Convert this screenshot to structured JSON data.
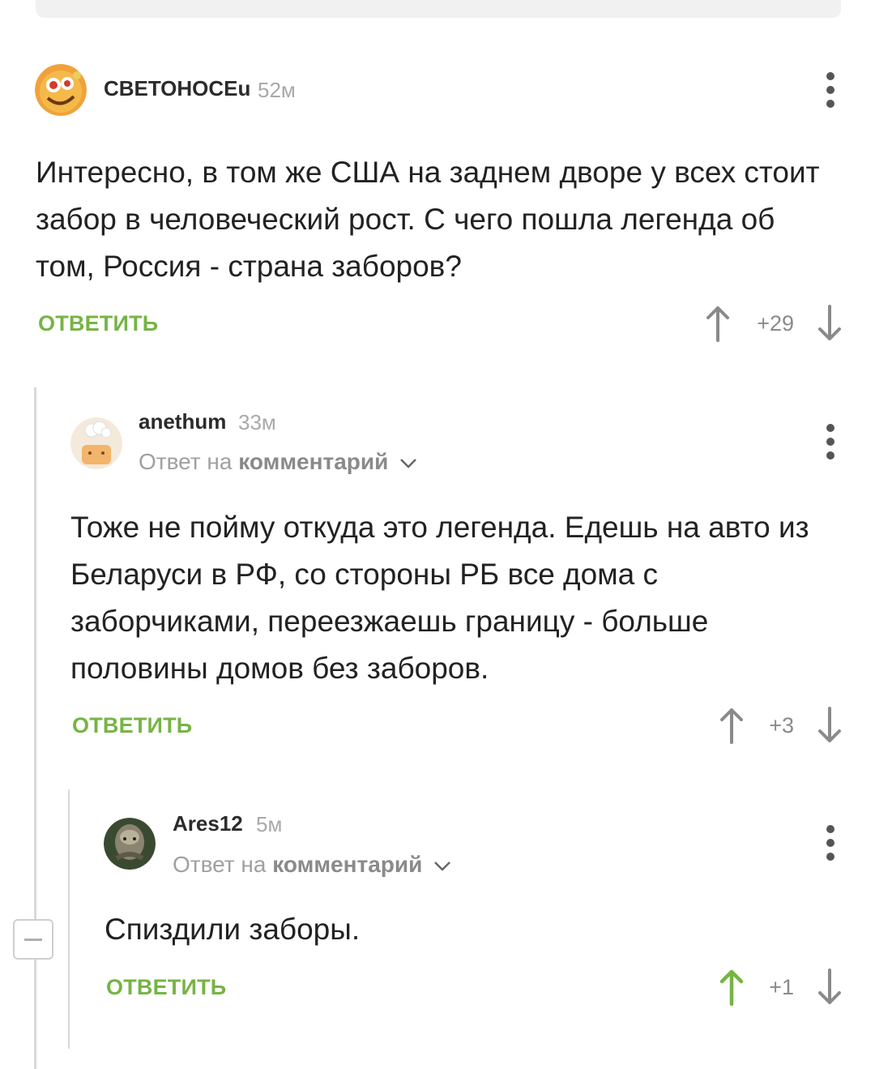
{
  "comments": [
    {
      "username": "СВЕТОНОСЕu",
      "time": "52м",
      "text": "Интересно, в том же США на заднем дворе у всех стоит забор в человеческий рост. С чего пошла легенда об том, Россия - страна заборов?",
      "reply_label": "ОТВЕТИТЬ",
      "score": "+29",
      "upvoted": false
    },
    {
      "username": "anethum",
      "time": "33м",
      "reply_to_prefix": "Ответ на",
      "reply_to_link": "комментарий",
      "text": "Тоже не пойму откуда это легенда. Едешь на авто из Беларуси в РФ, со стороны РБ все дома с заборчиками, переезжаешь границу - больше половины домов без заборов.",
      "reply_label": "ОТВЕТИТЬ",
      "score": "+3",
      "upvoted": false
    },
    {
      "username": "Ares12",
      "time": "5м",
      "reply_to_prefix": "Ответ на",
      "reply_to_link": "комментарий",
      "text": "Спиздили заборы.",
      "reply_label": "ОТВЕТИТЬ",
      "score": "+1",
      "upvoted": true
    }
  ],
  "colors": {
    "accent_green": "#76b444",
    "arrow_gray": "#8a8a8a",
    "thread_line": "#d8d8d8"
  },
  "icons": [
    "kebab-menu-icon",
    "upvote-arrow-icon",
    "downvote-arrow-icon",
    "chevron-down-icon",
    "collapse-thread-icon"
  ]
}
